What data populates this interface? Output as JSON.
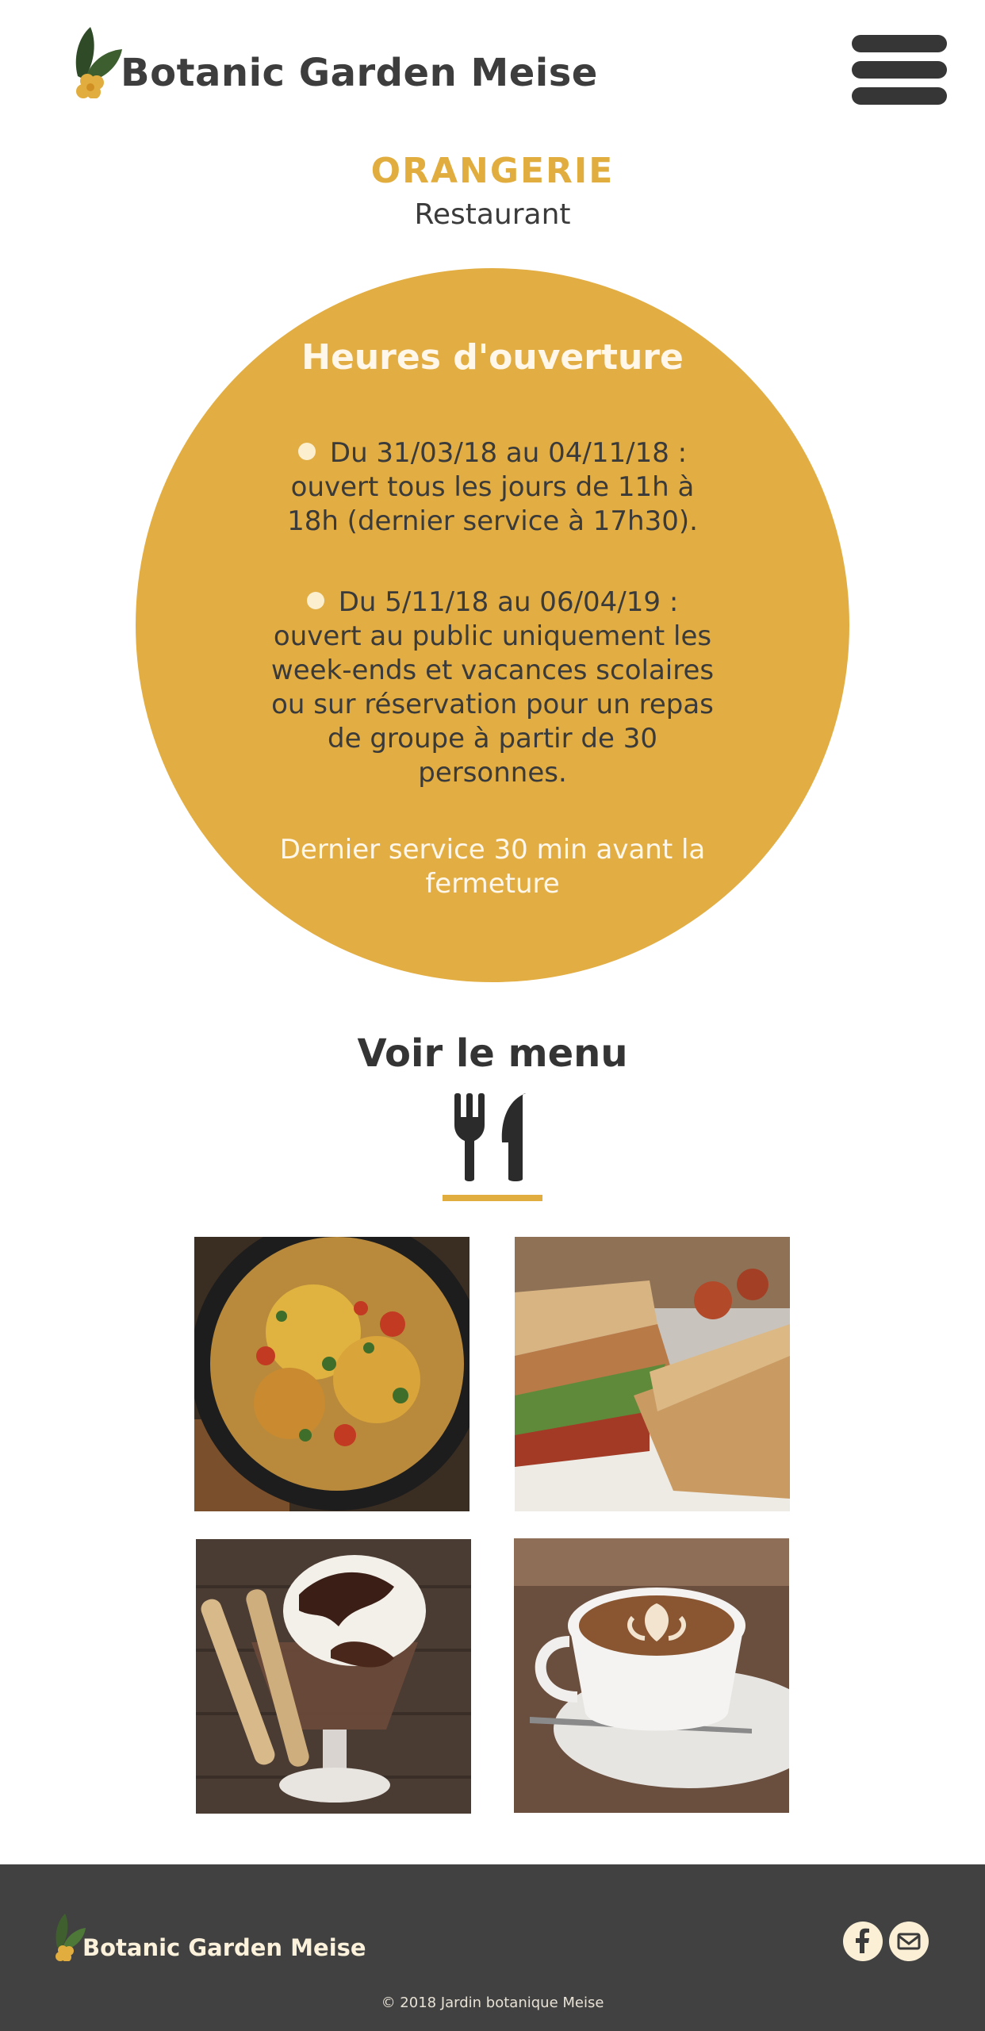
{
  "header": {
    "brand": "Botanic Garden Meise",
    "logo_icon": "leaf-flower-logo",
    "menu_icon": "hamburger-menu-icon"
  },
  "page": {
    "title": "ORANGERIE",
    "subtitle": "Restaurant"
  },
  "hours": {
    "title": "Heures d'ouverture",
    "periods": [
      {
        "text": "Du 31/03/18 au 04/11/18 : ouvert tous les jours de 11h à 18h (dernier service à 17h30)."
      },
      {
        "text": "Du 5/11/18 au 06/04/19 : ouvert au public uniquement les week-ends et vacances scolaires ou sur réservation pour un repas de groupe à partir de 30 personnes."
      }
    ],
    "last_service": "Dernier service 30 min avant la fermeture"
  },
  "menu": {
    "label": "Voir le menu",
    "icon": "fork-knife-icon"
  },
  "gallery": [
    {
      "icon": "skillet-photo"
    },
    {
      "icon": "sandwich-photo"
    },
    {
      "icon": "sundae-photo"
    },
    {
      "icon": "coffee-photo"
    }
  ],
  "footer": {
    "brand": "Botanic Garden Meise",
    "social": [
      "facebook-icon",
      "email-icon"
    ],
    "copyright": "© 2018 Jardin botanique Meise"
  },
  "colors": {
    "accent": "#e2ad3f",
    "circle": "#e2ae43",
    "footer_bg": "#414141",
    "text_dark": "#3b3b3b",
    "cream": "#fbefcf"
  }
}
